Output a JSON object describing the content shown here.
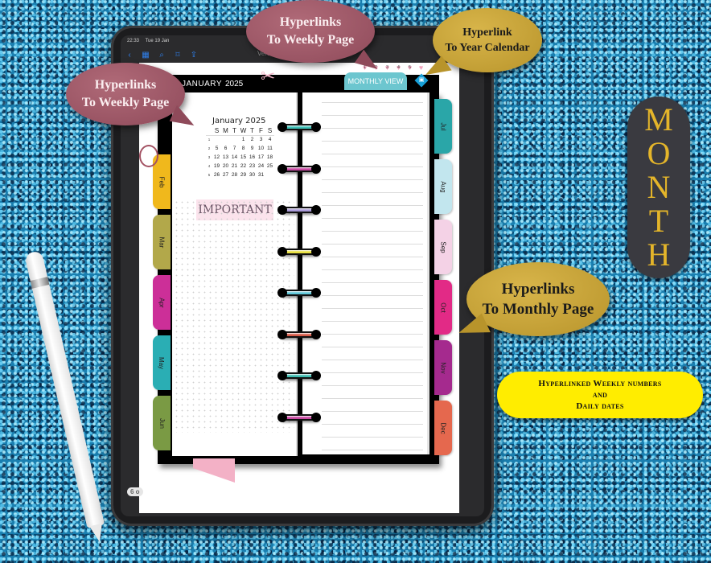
{
  "tablet": {
    "status_time": "22:33",
    "status_date": "Tue 19 Jan",
    "document_title": "Vertical_Monday (1)",
    "toolbar_icons": [
      "back-icon",
      "grid-icon",
      "search-icon",
      "bookmark-icon",
      "share-icon"
    ],
    "toolbar_glyphs": [
      "‹",
      "▦",
      "⌕",
      "⌑",
      "⇪"
    ],
    "page_badge": "6 o"
  },
  "planner": {
    "month_label": "JANUARY",
    "year_label": "2025",
    "monthly_view_tab": "MONTHLY VIEW",
    "year_link_glyph": "▣",
    "week_links": [
      "1",
      "2",
      "3",
      "4",
      "5",
      ""
    ],
    "mini_calendar": {
      "title": "January 2025",
      "weekdays": [
        "S",
        "M",
        "T",
        "W",
        "T",
        "F",
        "S"
      ],
      "weeks": [
        {
          "num": "1",
          "days": [
            "",
            "",
            "",
            "1",
            "2",
            "3",
            "4"
          ]
        },
        {
          "num": "2",
          "days": [
            "5",
            "6",
            "7",
            "8",
            "9",
            "10",
            "11"
          ]
        },
        {
          "num": "3",
          "days": [
            "12",
            "13",
            "14",
            "15",
            "16",
            "17",
            "18"
          ]
        },
        {
          "num": "4",
          "days": [
            "19",
            "20",
            "21",
            "22",
            "23",
            "24",
            "25"
          ]
        },
        {
          "num": "5",
          "days": [
            "26",
            "27",
            "28",
            "29",
            "30",
            "31",
            ""
          ]
        }
      ]
    },
    "important_label": "IMPORTANT",
    "left_tabs": [
      {
        "label": "Feb",
        "color": "#f0b81c"
      },
      {
        "label": "Mar",
        "color": "#b2a84a"
      },
      {
        "label": "Apr",
        "color": "#cc2f98"
      },
      {
        "label": "May",
        "color": "#2aaeb4"
      },
      {
        "label": "Jun",
        "color": "#7a9a44"
      }
    ],
    "right_tabs": [
      {
        "label": "Jul",
        "color": "#2aa6a8"
      },
      {
        "label": "Aug",
        "color": "#c2e6ee"
      },
      {
        "label": "Sep",
        "color": "#f4d2e6"
      },
      {
        "label": "Oct",
        "color": "#e22a86"
      },
      {
        "label": "Nov",
        "color": "#a52a8e"
      },
      {
        "label": "Dec",
        "color": "#e5684e"
      }
    ],
    "ring_colors": [
      "#3fc1b8",
      "#c94aa3",
      "#a99ad8",
      "#e8e040",
      "#5fc6d8",
      "#d65a48",
      "#3fbcb0",
      "#c94aa3"
    ]
  },
  "callouts": {
    "weekly_left": {
      "line1": "Hyperlinks",
      "line2": "To Weekly Page"
    },
    "weekly_top": {
      "line1": "Hyperlinks",
      "line2": "To Weekly Page"
    },
    "year": {
      "line1": "Hyperlink",
      "line2": "To Year Calendar"
    },
    "monthly": {
      "line1": "Hyperlinks",
      "line2": "To Monthly Page"
    },
    "month_badge": [
      "M",
      "O",
      "N",
      "T",
      "H"
    ],
    "info_pill": {
      "line1": "Hyperlinked Weekly numbers",
      "line2": "and",
      "line3": "Daily dates"
    }
  }
}
